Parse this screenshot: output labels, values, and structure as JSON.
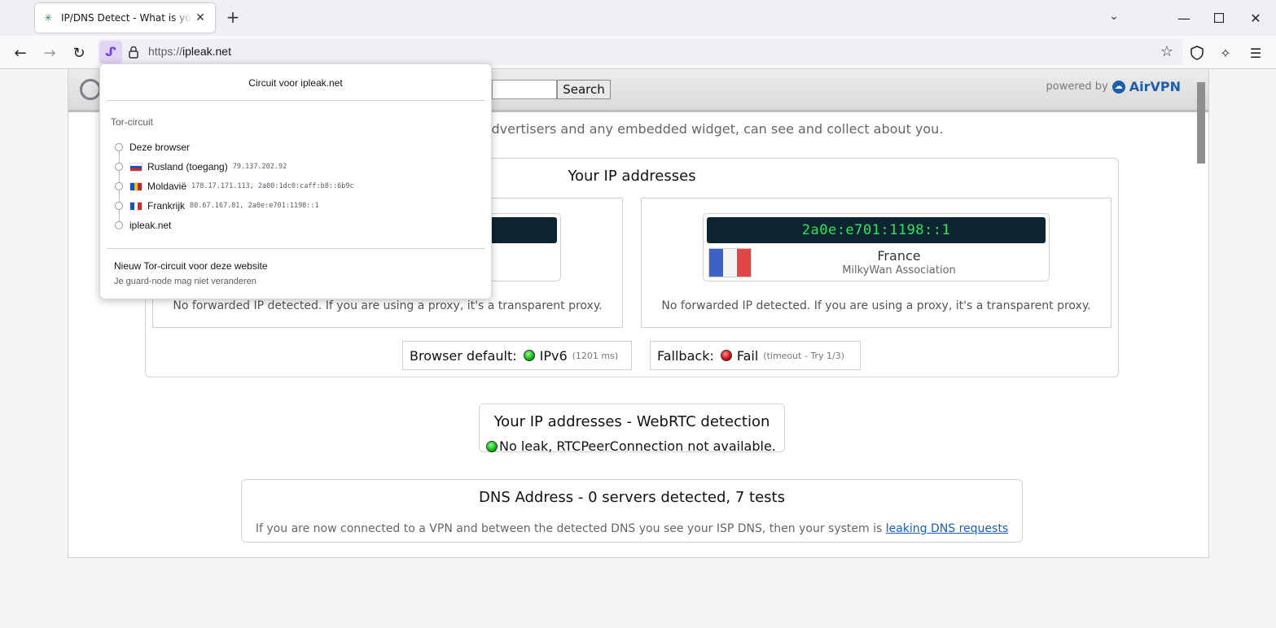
{
  "browser": {
    "tab_title": "IP/DNS Detect - What is your IP",
    "url_scheme": "https://",
    "url_host": "ipleak.net"
  },
  "site": {
    "search_button": "Search",
    "powered_by": "powered by",
    "brand": "AirVPN",
    "intro": "u visit, as well as their advertisers and any embedded widget, can see and collect about you."
  },
  "ip_panel": {
    "title": "Your IP addresses",
    "right": {
      "ip": "2a0e:e701:1198::1",
      "country": "France",
      "isp": "MilkyWan Association"
    },
    "forward_note_left": "No forwarded IP detected. If you are using a proxy, it's a transparent proxy.",
    "forward_note_right": "No forwarded IP detected. If you are using a proxy, it's a transparent proxy.",
    "browser_default_label": "Browser default:",
    "browser_default_value": "IPv6",
    "browser_default_detail": "(1201 ms)",
    "fallback_label": "Fallback:",
    "fallback_value": "Fail",
    "fallback_detail": "(timeout - Try 1/3)"
  },
  "webrtc": {
    "title": "Your IP addresses - WebRTC detection",
    "status": "No leak, RTCPeerConnection not available."
  },
  "dns": {
    "title": "DNS Address - 0 servers detected, 7 tests",
    "note": "If you are now connected to a VPN and between the detected DNS you see your ISP DNS, then your system is ",
    "link": "leaking DNS requests"
  },
  "popup": {
    "title": "Circuit voor ipleak.net",
    "section": "Tor-circuit",
    "hops": [
      {
        "name": "Deze browser",
        "ip": ""
      },
      {
        "name": "Rusland (toegang)",
        "ip": "79.137.202.92"
      },
      {
        "name": "Moldavië",
        "ip": "178.17.171.113, 2a00:1dc0:caff:b8::6b9c"
      },
      {
        "name": "Frankrijk",
        "ip": "80.67.167.81, 2a0e:e701:1198::1"
      },
      {
        "name": "ipleak.net",
        "ip": ""
      }
    ],
    "action": "Nieuw Tor-circuit voor deze website",
    "hint": "Je guard-node mag niet veranderen"
  },
  "colors": {
    "accent": "#7542e5",
    "lcd_bg": "#0c2530",
    "lcd_text": "#2fe35c",
    "link": "#1a5fb4"
  }
}
